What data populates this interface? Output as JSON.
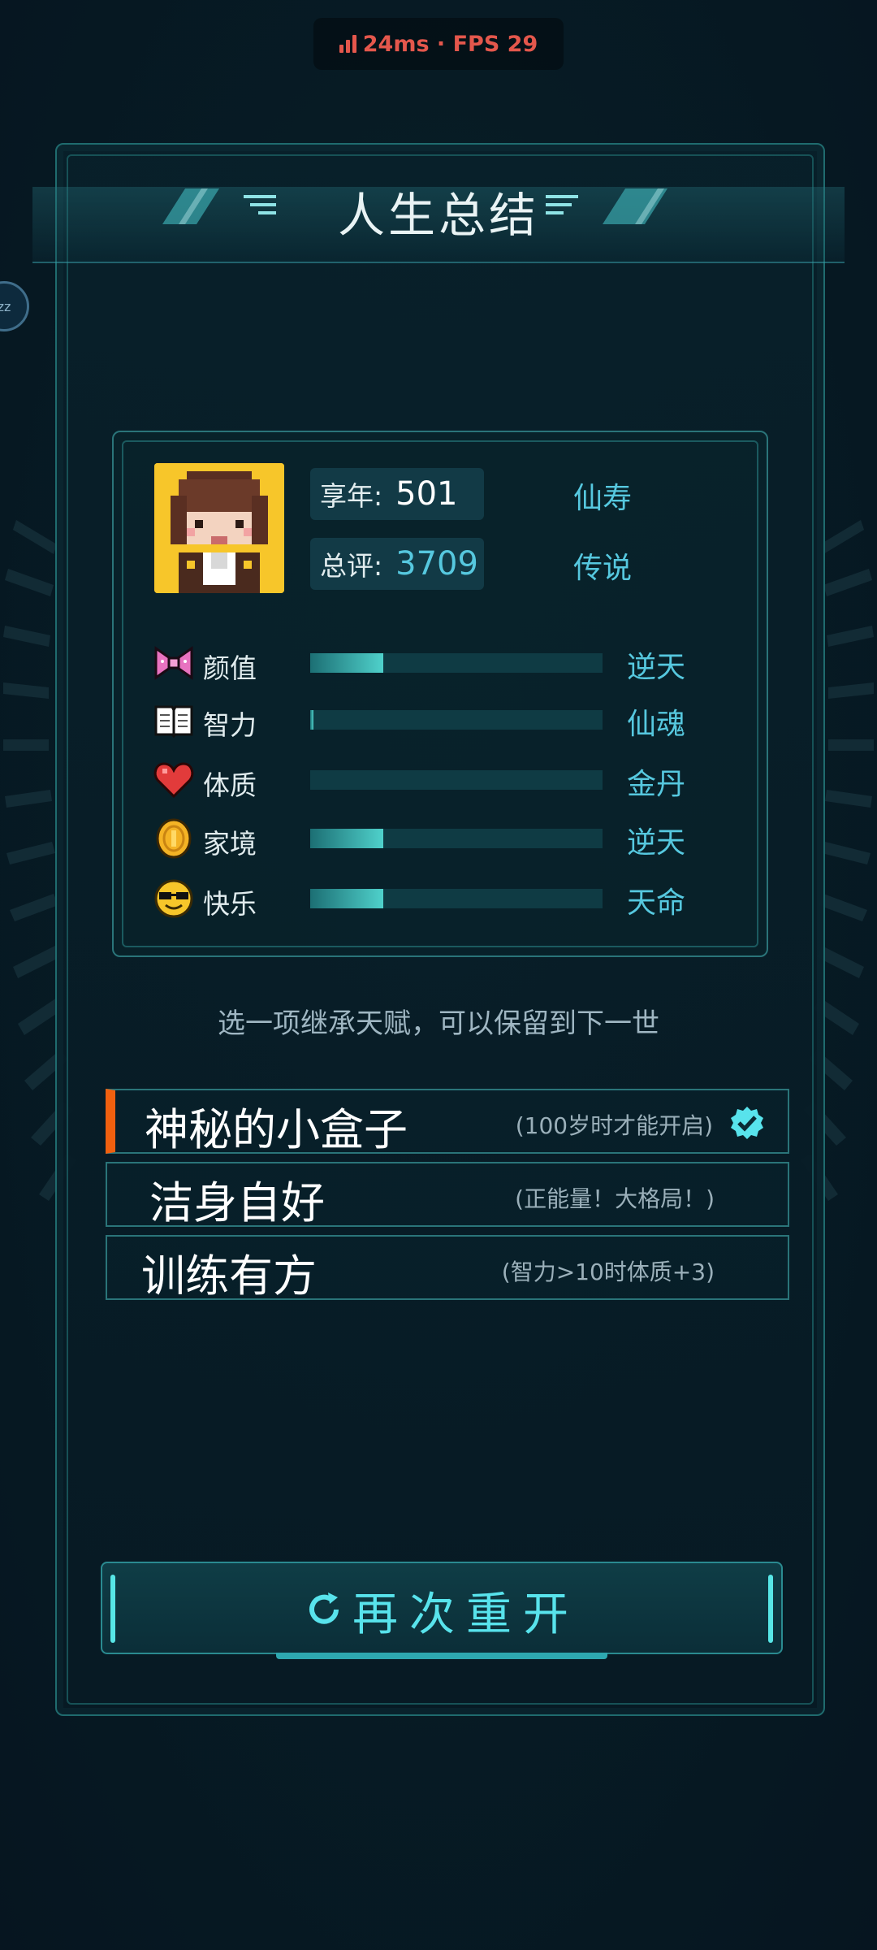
{
  "perf": {
    "text": "24ms · FPS 29"
  },
  "side_bubble": {
    "text": "zz"
  },
  "title": "人生总结",
  "summary": {
    "age_label": "享年:",
    "age_value": "501",
    "age_grade": "仙寿",
    "score_label": "总评:",
    "score_value": "3709",
    "score_grade": "传说"
  },
  "attributes": [
    {
      "name": "颜值",
      "icon": "bow-icon",
      "level": "逆天",
      "fill": 0.25
    },
    {
      "name": "智力",
      "icon": "book-icon",
      "level": "仙魂",
      "fill": 0.01
    },
    {
      "name": "体质",
      "icon": "heart-icon",
      "level": "金丹",
      "fill": 0.0
    },
    {
      "name": "家境",
      "icon": "coin-icon",
      "level": "逆天",
      "fill": 0.25
    },
    {
      "name": "快乐",
      "icon": "sunglasses-face-icon",
      "level": "天命",
      "fill": 0.25
    }
  ],
  "hint": "选一项继承天赋，可以保留到下一世",
  "talents": [
    {
      "name": "神秘的小盒子",
      "desc": "(100岁时才能开启)",
      "selected": true
    },
    {
      "name": "洁身自好",
      "desc": "(正能量！大格局！)",
      "selected": false
    },
    {
      "name": "训练有方",
      "desc": "(智力>10时体质+3)",
      "selected": false
    }
  ],
  "restart_label": "再次重开",
  "colors": {
    "accent": "#56c8df",
    "selected": "#f0600f",
    "button_text": "#58e3ec"
  }
}
